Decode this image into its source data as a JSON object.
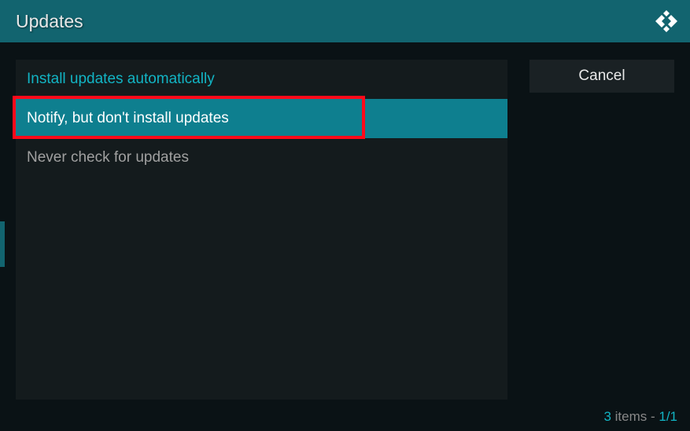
{
  "header": {
    "title": "Updates"
  },
  "options": [
    {
      "label": "Install updates automatically",
      "state": "current"
    },
    {
      "label": "Notify, but don't install updates",
      "state": "highlighted"
    },
    {
      "label": "Never check for updates",
      "state": "normal"
    }
  ],
  "sidebar": {
    "cancel_label": "Cancel"
  },
  "footer": {
    "count": "3",
    "items_text": " items - ",
    "page": "1/1"
  }
}
